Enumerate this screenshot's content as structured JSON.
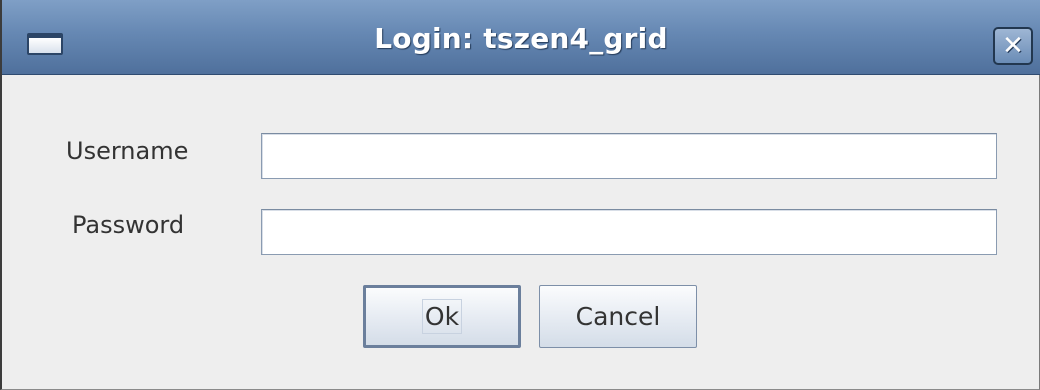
{
  "window": {
    "title": "Login: tszen4_grid",
    "menu_icon": "window-menu-icon",
    "close_glyph": "✕"
  },
  "form": {
    "username": {
      "label": "Username",
      "value": "",
      "placeholder": ""
    },
    "password": {
      "label": "Password",
      "value": "",
      "placeholder": ""
    }
  },
  "buttons": {
    "ok_label": "Ok",
    "cancel_label": "Cancel"
  },
  "colors": {
    "titlebar_accent": "#6688b3",
    "window_background": "#eeeeee"
  }
}
